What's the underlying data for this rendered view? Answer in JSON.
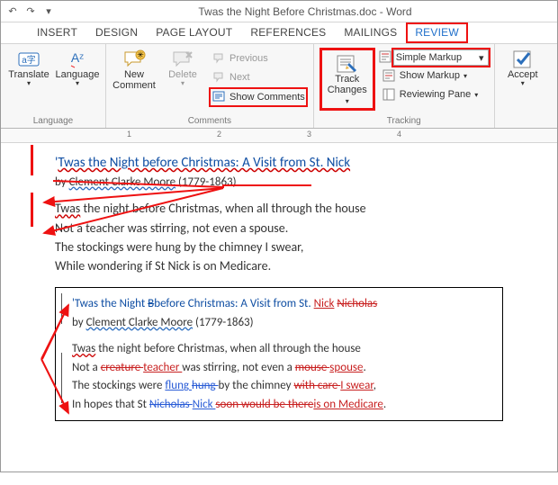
{
  "window": {
    "title": "Twas the Night Before Christmas.doc - Word"
  },
  "tabs": {
    "insert": "INSERT",
    "design": "DESIGN",
    "pagelayout": "PAGE LAYOUT",
    "references": "REFERENCES",
    "mailings": "MAILINGS",
    "review": "REVIEW"
  },
  "ribbon": {
    "translate": "Translate",
    "language": "Language",
    "newcomment": "New Comment",
    "delete": "Delete",
    "previous": "Previous",
    "next": "Next",
    "showcomments": "Show Comments",
    "track_l1": "Track",
    "track_l2": "Changes",
    "markup_mode": "Simple Markup",
    "showmarkup": "Show Markup",
    "reviewpane": "Reviewing Pane",
    "accept": "Accept",
    "group_language": "Language",
    "group_comments": "Comments",
    "group_tracking": "Tracking"
  },
  "ruler": {
    "n1": "1",
    "n2": "2",
    "n3": "3",
    "n4": "4"
  },
  "doc": {
    "title_pre": "'",
    "title_main": "Twas the Night before Christmas: A Visit from St. Nick",
    "byline_pre": "by ",
    "byline_name": "Clement Clarke Moore",
    "byline_dates": " (1779-1863)",
    "p1_w": "Twas",
    "p1_rest": " the night before Christmas, when all through the house",
    "p2": "Not a teacher was stirring, not even a spouse.",
    "p3": "The stockings were hung by the chimney I swear,",
    "p4": "While wondering if St Nick is on Medicare."
  },
  "inset": {
    "t_pre": "'Twas the Night ",
    "t_Bb": "Bb",
    "t_mid": "efore Christmas: A Visit from St. ",
    "t_nick": "Nick",
    "t_nicholas": "Nicholas",
    "byline_pre": "by ",
    "byline_name": "Clement Clarke Moore",
    "byline_dates": " (1779-1863)",
    "l1_w": "Twas",
    "l1_rest": " the night before Christmas, when all through the house",
    "l2_a": "Not a ",
    "l2_creat": "creature ",
    "l2_teach": "teacher ",
    "l2_b": "was stirring, not even a ",
    "l2_mouse": "mouse ",
    "l2_spouse": "spouse",
    "l2_end": ".",
    "l3_a": "The stockings were ",
    "l3_flung": "flung ",
    "l3_hung": "hung ",
    "l3_b": "by the chimney ",
    "l3_wc": "with care ",
    "l3_is": "I swear",
    "l3_end": ",",
    "l4_a": "In hopes that St ",
    "l4_nich": "Nicholas ",
    "l4_nick": "Nick ",
    "l4_soon": "soon would be there",
    "l4_med": "is on Medicare",
    "l4_end": "."
  }
}
